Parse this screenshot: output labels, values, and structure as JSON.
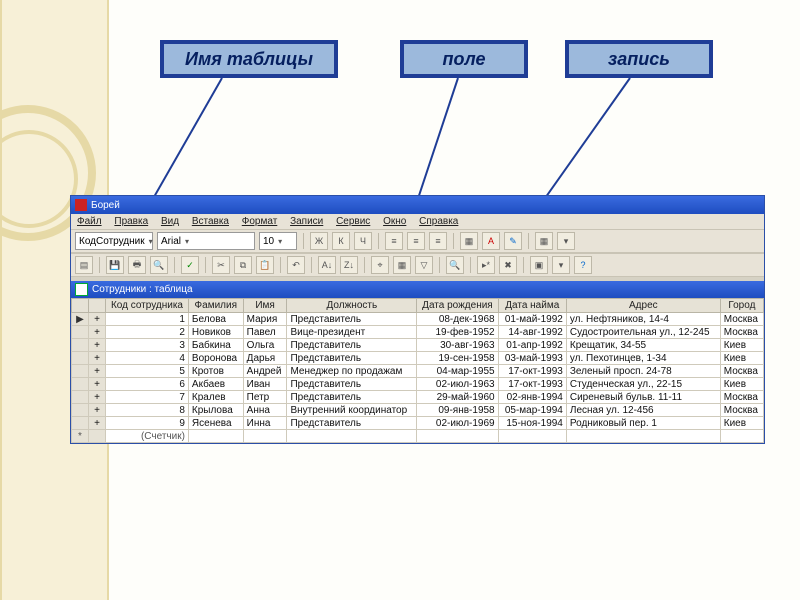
{
  "callouts": {
    "table_name": "Имя таблицы",
    "field": "поле",
    "record": "запись"
  },
  "app": {
    "title": "Борей",
    "menu": [
      "Файл",
      "Правка",
      "Вид",
      "Вставка",
      "Формат",
      "Записи",
      "Сервис",
      "Окно",
      "Справка"
    ],
    "toolbar": {
      "field_label": "КодСотрудник",
      "font_name": "Arial",
      "font_size": "10",
      "buttons": {
        "bold": "Ж",
        "italic": "К",
        "underline": "Ч"
      }
    },
    "sub_title": "Сотрудники : таблица",
    "columns": [
      "Код сотрудника",
      "Фамилия",
      "Имя",
      "Должность",
      "Дата рождения",
      "Дата найма",
      "Адрес",
      "Город"
    ],
    "rows": [
      {
        "id": "1",
        "last": "Белова",
        "first": "Мария",
        "pos": "Представитель",
        "dob": "08-дек-1968",
        "hire": "01-май-1992",
        "addr": "ул. Нефтяников, 14-4",
        "city": "Москва"
      },
      {
        "id": "2",
        "last": "Новиков",
        "first": "Павел",
        "pos": "Вице-президент",
        "dob": "19-фев-1952",
        "hire": "14-авг-1992",
        "addr": "Судостроительная ул., 12-245",
        "city": "Москва"
      },
      {
        "id": "3",
        "last": "Бабкина",
        "first": "Ольга",
        "pos": "Представитель",
        "dob": "30-авг-1963",
        "hire": "01-апр-1992",
        "addr": "Крещатик, 34-55",
        "city": "Киев"
      },
      {
        "id": "4",
        "last": "Воронова",
        "first": "Дарья",
        "pos": "Представитель",
        "dob": "19-сен-1958",
        "hire": "03-май-1993",
        "addr": "ул. Пехотинцев, 1-34",
        "city": "Киев"
      },
      {
        "id": "5",
        "last": "Кротов",
        "first": "Андрей",
        "pos": "Менеджер по продажам",
        "dob": "04-мар-1955",
        "hire": "17-окт-1993",
        "addr": "Зеленый просп. 24-78",
        "city": "Москва"
      },
      {
        "id": "6",
        "last": "Акбаев",
        "first": "Иван",
        "pos": "Представитель",
        "dob": "02-июл-1963",
        "hire": "17-окт-1993",
        "addr": "Студенческая ул., 22-15",
        "city": "Киев"
      },
      {
        "id": "7",
        "last": "Кралев",
        "first": "Петр",
        "pos": "Представитель",
        "dob": "29-май-1960",
        "hire": "02-янв-1994",
        "addr": "Сиреневый бульв. 11-11",
        "city": "Москва"
      },
      {
        "id": "8",
        "last": "Крылова",
        "first": "Анна",
        "pos": "Внутренний координатор",
        "dob": "09-янв-1958",
        "hire": "05-мар-1994",
        "addr": "Лесная ул. 12-456",
        "city": "Москва"
      },
      {
        "id": "9",
        "last": "Ясенева",
        "first": "Инна",
        "pos": "Представитель",
        "dob": "02-июл-1969",
        "hire": "15-ноя-1994",
        "addr": "Родниковый пер. 1",
        "city": "Киев"
      }
    ],
    "counter_label": "(Счетчик)",
    "row_marker": "▶",
    "expand_marker": "+",
    "new_marker": "*"
  }
}
